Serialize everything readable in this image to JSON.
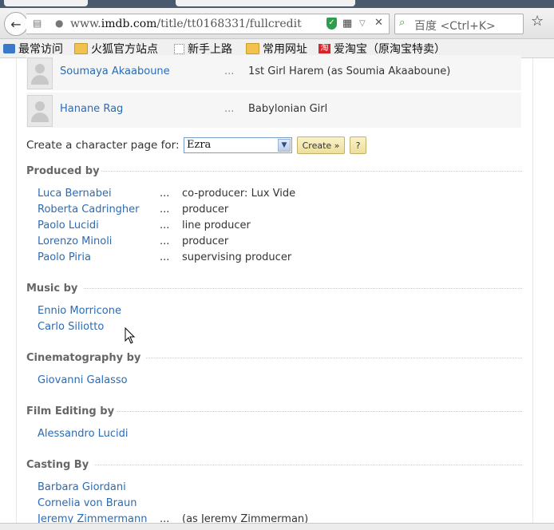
{
  "browser": {
    "url_prefix": "www.",
    "url_domain": "imdb.com",
    "url_path": "/title/tt0168331/fullcredit",
    "search_placeholder": "百度 <Ctrl+K>",
    "bookmarks": [
      {
        "label": "最常访问",
        "icon": "blue"
      },
      {
        "label": "火狐官方站点",
        "icon": "folder"
      },
      {
        "label": "新手上路",
        "icon": "dotted"
      },
      {
        "label": "常用网址",
        "icon": "folder"
      },
      {
        "label": "爱淘宝（原淘宝特卖）",
        "icon": "red"
      }
    ]
  },
  "cast": [
    {
      "name": "Soumaya Akaaboune",
      "dots": "...",
      "character": "1st Girl Harem (as Soumia Akaaboune)"
    },
    {
      "name": "Hanane Rag",
      "dots": "...",
      "character": "Babylonian Girl"
    }
  ],
  "create_character": {
    "label": "Create a character page for:",
    "selected": "Ezra",
    "create_button": "Create »",
    "help_button": "?"
  },
  "sections": {
    "produced_by": {
      "title": "Produced by",
      "rows": [
        {
          "name": "Luca Bernabei",
          "dots": "...",
          "role": "co-producer: Lux Vide"
        },
        {
          "name": "Roberta Cadringher",
          "dots": "...",
          "role": "producer"
        },
        {
          "name": "Paolo Lucidi",
          "dots": "...",
          "role": "line producer"
        },
        {
          "name": "Lorenzo Minoli",
          "dots": "...",
          "role": "producer"
        },
        {
          "name": "Paolo Piria",
          "dots": "...",
          "role": "supervising producer"
        }
      ]
    },
    "music_by": {
      "title": "Music by",
      "rows": [
        {
          "name": "Ennio Morricone"
        },
        {
          "name": "Carlo Siliotto"
        }
      ]
    },
    "cinematography_by": {
      "title": "Cinematography by",
      "rows": [
        {
          "name": "Giovanni Galasso"
        }
      ]
    },
    "film_editing_by": {
      "title": "Film Editing by",
      "rows": [
        {
          "name": "Alessandro Lucidi"
        }
      ]
    },
    "casting_by": {
      "title": "Casting By",
      "rows": [
        {
          "name": "Barbara Giordani"
        },
        {
          "name": "Cornelia von Braun"
        },
        {
          "name": "Jeremy Zimmermann",
          "dots": "...",
          "role": "(as Jeremy Zimmerman)"
        }
      ]
    }
  }
}
